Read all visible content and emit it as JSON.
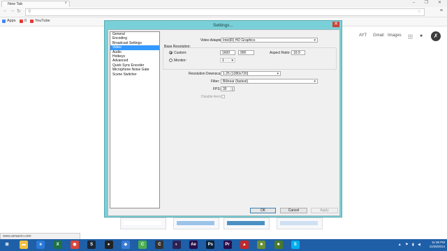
{
  "browser": {
    "tab_title": "New Tab",
    "tab_close": "×",
    "window_controls": "– ❐ ✕",
    "bookmarks": [
      {
        "label": "Apps",
        "color": "#4285f4"
      },
      {
        "label": "0",
        "color": "#e53935"
      },
      {
        "label": "YouTube",
        "color": "#e53935"
      }
    ],
    "google_links": [
      "AYT",
      "Gmail",
      "Images"
    ],
    "avatar_glyph": "✗"
  },
  "dialog": {
    "title": "Settings...",
    "close": "✕",
    "categories": [
      "General",
      "Encoding",
      "Broadcast Settings",
      "Video",
      "Audio",
      "Hotkeys",
      "Advanced",
      "Quick Sync Encoder",
      "Microphone Noise Gate",
      "Scene Switcher"
    ],
    "selected_category": "Video",
    "video_adapter_label": "Video Adapter:",
    "video_adapter_value": "Intel(R) HD Graphics",
    "base_resolution_label": "Base Resolution:",
    "custom_label": "Custom:",
    "width_value": "1600",
    "height_value": "900",
    "aspect_ratio_label": "Aspect Ratio:",
    "aspect_ratio_value": "16:9",
    "monitor_label": "Monitor:",
    "monitor_value": "1",
    "downscale_label": "Resolution Downscale:",
    "downscale_value": "1.25  (1280x720)",
    "filter_label": "Filter:",
    "filter_value": "Bilinear (fastest)",
    "fps_label": "FPS:",
    "fps_value": "30",
    "disable_aero_label": "Disable Aero:",
    "ok_label": "OK",
    "cancel_label": "Cancel",
    "apply_label": "Apply"
  },
  "status_text": "www.amazon.com",
  "taskbar": {
    "apps": [
      {
        "name": "file-explorer",
        "glyph": "▬",
        "color": "#f0c040"
      },
      {
        "name": "internet-explorer",
        "glyph": "e",
        "color": "#2a7bd8"
      },
      {
        "name": "excel",
        "glyph": "X",
        "color": "#1e7145"
      },
      {
        "name": "chrome",
        "glyph": "◉",
        "color": "#db4437"
      },
      {
        "name": "steam",
        "glyph": "S",
        "color": "#1b2838"
      },
      {
        "name": "obs",
        "glyph": "●",
        "color": "#222222"
      },
      {
        "name": "app-blue",
        "glyph": "◆",
        "color": "#3a7bd5"
      },
      {
        "name": "camtasia",
        "glyph": "C",
        "color": "#4caf50"
      },
      {
        "name": "app-c",
        "glyph": "C",
        "color": "#333333"
      },
      {
        "name": "eclipse",
        "glyph": "◐",
        "color": "#2c2255"
      },
      {
        "name": "after-effects",
        "glyph": "Ae",
        "color": "#2a0e4a"
      },
      {
        "name": "photoshop",
        "glyph": "Ps",
        "color": "#0b2239"
      },
      {
        "name": "premiere",
        "glyph": "Pr",
        "color": "#2a0e4a"
      },
      {
        "name": "app-red",
        "glyph": "▲",
        "color": "#c62828"
      },
      {
        "name": "minecraft",
        "glyph": "■",
        "color": "#6a8f3a"
      },
      {
        "name": "minecraft-server",
        "glyph": "■",
        "color": "#4a7a2a"
      },
      {
        "name": "skype",
        "glyph": "S",
        "color": "#00aff0"
      }
    ],
    "time": "11:36 PM",
    "date": "11/26/2014"
  }
}
